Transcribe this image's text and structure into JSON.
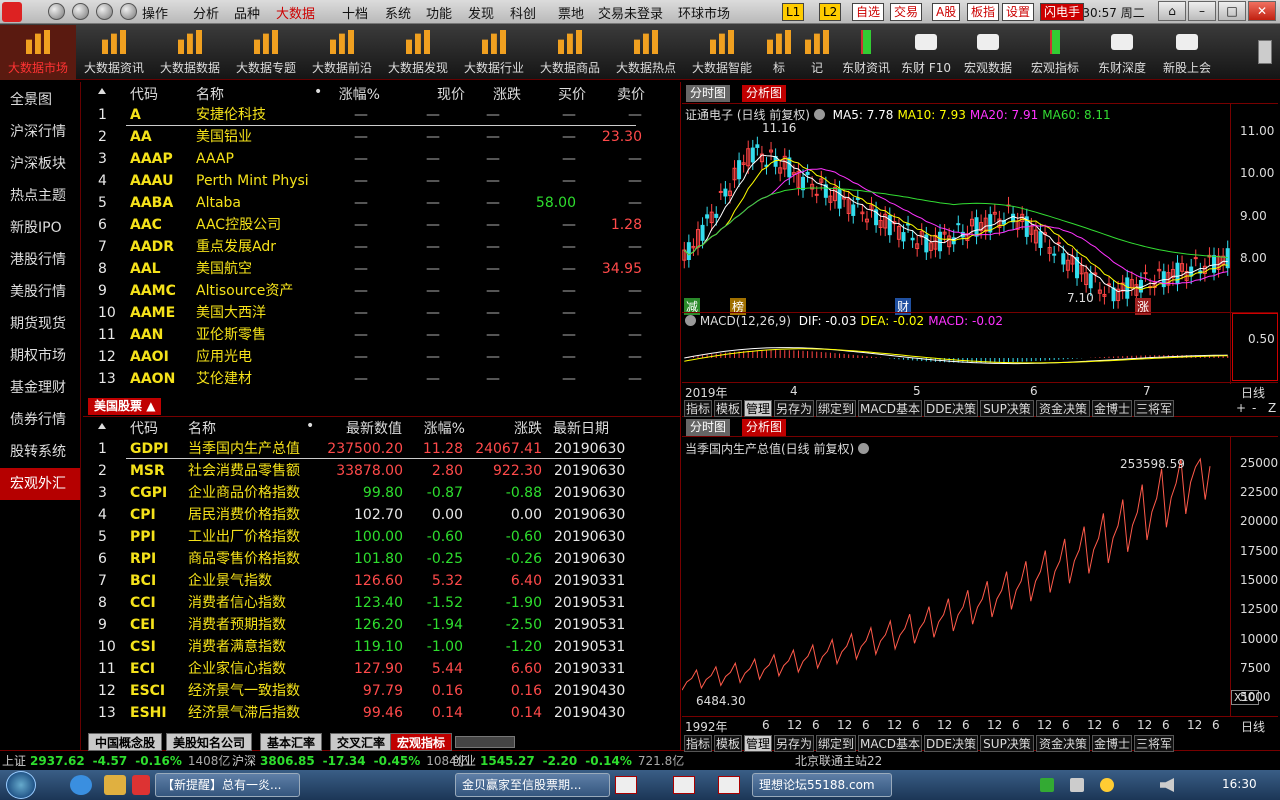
{
  "menubar": {
    "items": [
      "操作",
      "分析",
      "品种",
      "大数据",
      "十档",
      "系统",
      "功能",
      "发现",
      "科创",
      "票地",
      "交易未登录",
      "环球市场"
    ],
    "active_index": 3,
    "toggles": [
      "L1",
      "L2",
      "自选",
      "交易",
      "A股",
      "板指",
      "设置",
      "闪电手"
    ],
    "clock": "16:30:57",
    "weekday": "周二"
  },
  "toolbar": {
    "items": [
      "大数据市场",
      "大数据资讯",
      "大数据数据",
      "大数据专题",
      "大数据前沿",
      "大数据发现",
      "大数据行业",
      "大数据商品",
      "大数据热点",
      "大数据智能",
      "标",
      "记",
      "东财资讯",
      "东财 F10",
      "宏观数据",
      "宏观指标",
      "东财深度",
      "新股上会"
    ],
    "active_index": 0
  },
  "sidebar": {
    "items": [
      "全景图",
      "沪深行情",
      "沪深板块",
      "热点主题",
      "新股IPO",
      "港股行情",
      "美股行情",
      "期货现货",
      "期权市场",
      "基金理财",
      "债券行情",
      "股转系统",
      "宏观外汇"
    ],
    "active_index": 12
  },
  "us_table": {
    "headers": [
      "代码",
      "名称",
      "•",
      "涨幅%",
      "现价",
      "涨跌",
      "买价",
      "卖价"
    ],
    "rows": [
      {
        "n": "1",
        "code": "A",
        "name": "安捷伦科技",
        "chg": "—",
        "price": "—",
        "diff": "—",
        "bid": "—",
        "ask": "—"
      },
      {
        "n": "2",
        "code": "AA",
        "name": "美国铝业",
        "chg": "—",
        "price": "—",
        "diff": "—",
        "bid": "—",
        "ask": "23.30"
      },
      {
        "n": "3",
        "code": "AAAP",
        "name": "AAAP",
        "chg": "—",
        "price": "—",
        "diff": "—",
        "bid": "—",
        "ask": "—"
      },
      {
        "n": "4",
        "code": "AAAU",
        "name": "Perth Mint Physi",
        "chg": "—",
        "price": "—",
        "diff": "—",
        "bid": "—",
        "ask": "—"
      },
      {
        "n": "5",
        "code": "AABA",
        "name": "Altaba",
        "chg": "—",
        "price": "—",
        "diff": "—",
        "bid": "58.00",
        "ask": "—"
      },
      {
        "n": "6",
        "code": "AAC",
        "name": "AAC控股公司",
        "chg": "—",
        "price": "—",
        "diff": "—",
        "bid": "—",
        "ask": "1.28"
      },
      {
        "n": "7",
        "code": "AADR",
        "name": "重点发展Adr",
        "chg": "—",
        "price": "—",
        "diff": "—",
        "bid": "—",
        "ask": "—"
      },
      {
        "n": "8",
        "code": "AAL",
        "name": "美国航空",
        "chg": "—",
        "price": "—",
        "diff": "—",
        "bid": "—",
        "ask": "34.95"
      },
      {
        "n": "9",
        "code": "AAMC",
        "name": "Altisource资产",
        "chg": "—",
        "price": "—",
        "diff": "—",
        "bid": "—",
        "ask": "—"
      },
      {
        "n": "10",
        "code": "AAME",
        "name": "美国大西洋",
        "chg": "—",
        "price": "—",
        "diff": "—",
        "bid": "—",
        "ask": "—"
      },
      {
        "n": "11",
        "code": "AAN",
        "name": "亚伦斯零售",
        "chg": "—",
        "price": "—",
        "diff": "—",
        "bid": "—",
        "ask": "—"
      },
      {
        "n": "12",
        "code": "AAOI",
        "name": "应用光电",
        "chg": "—",
        "price": "—",
        "diff": "—",
        "bid": "—",
        "ask": "—"
      },
      {
        "n": "13",
        "code": "AAON",
        "name": "艾伦建材",
        "chg": "—",
        "price": "—",
        "diff": "—",
        "bid": "—",
        "ask": "—"
      }
    ],
    "tab_label": "美国股票"
  },
  "macro_table": {
    "headers": [
      "代码",
      "名称",
      "•",
      "最新数值",
      "涨幅%",
      "涨跌",
      "最新日期"
    ],
    "rows": [
      {
        "n": "1",
        "code": "GDPI",
        "name": "当季国内生产总值",
        "val": "237500.20",
        "chg": "11.28",
        "diff": "24067.41",
        "date": "20190630",
        "dir": "up"
      },
      {
        "n": "2",
        "code": "MSR",
        "name": "社会消费品零售额",
        "val": "33878.00",
        "chg": "2.80",
        "diff": "922.30",
        "date": "20190630",
        "dir": "up"
      },
      {
        "n": "3",
        "code": "CGPI",
        "name": "企业商品价格指数",
        "val": "99.80",
        "chg": "-0.87",
        "diff": "-0.88",
        "date": "20190630",
        "dir": "down"
      },
      {
        "n": "4",
        "code": "CPI",
        "name": "居民消费价格指数",
        "val": "102.70",
        "chg": "0.00",
        "diff": "0.00",
        "date": "20190630",
        "dir": "flat"
      },
      {
        "n": "5",
        "code": "PPI",
        "name": "工业出厂价格指数",
        "val": "100.00",
        "chg": "-0.60",
        "diff": "-0.60",
        "date": "20190630",
        "dir": "down"
      },
      {
        "n": "6",
        "code": "RPI",
        "name": "商品零售价格指数",
        "val": "101.80",
        "chg": "-0.25",
        "diff": "-0.26",
        "date": "20190630",
        "dir": "down"
      },
      {
        "n": "7",
        "code": "BCI",
        "name": "企业景气指数",
        "val": "126.60",
        "chg": "5.32",
        "diff": "6.40",
        "date": "20190331",
        "dir": "up"
      },
      {
        "n": "8",
        "code": "CCI",
        "name": "消费者信心指数",
        "val": "123.40",
        "chg": "-1.52",
        "diff": "-1.90",
        "date": "20190531",
        "dir": "down"
      },
      {
        "n": "9",
        "code": "CEI",
        "name": "消费者预期指数",
        "val": "126.20",
        "chg": "-1.94",
        "diff": "-2.50",
        "date": "20190531",
        "dir": "down"
      },
      {
        "n": "10",
        "code": "CSI",
        "name": "消费者满意指数",
        "val": "119.10",
        "chg": "-1.00",
        "diff": "-1.20",
        "date": "20190531",
        "dir": "down"
      },
      {
        "n": "11",
        "code": "ECI",
        "name": "企业家信心指数",
        "val": "127.90",
        "chg": "5.44",
        "diff": "6.60",
        "date": "20190331",
        "dir": "up"
      },
      {
        "n": "12",
        "code": "ESCI",
        "name": "经济景气一致指数",
        "val": "97.79",
        "chg": "0.16",
        "diff": "0.16",
        "date": "20190430",
        "dir": "up"
      },
      {
        "n": "13",
        "code": "ESHI",
        "name": "经济景气滞后指数",
        "val": "99.46",
        "chg": "0.14",
        "diff": "0.14",
        "date": "20190430",
        "dir": "up"
      }
    ]
  },
  "bottom_tabs": [
    "中国概念股",
    "美股知名公司",
    "基本汇率",
    "交叉汇率",
    "宏观指标"
  ],
  "bottom_tabs_active": 4,
  "chart_top": {
    "tabs": [
      "分时图",
      "分析图"
    ],
    "title": "证通电子 (日线 前复权)",
    "ma": [
      {
        "label": "MA5: 7.78",
        "color": "#ffffff"
      },
      {
        "label": "MA10: 7.93",
        "color": "#ffff00"
      },
      {
        "label": "MA20: 7.91",
        "color": "#ff33ff"
      },
      {
        "label": "MA60: 8.11",
        "color": "#33dd33"
      }
    ],
    "high_label": "11.16",
    "low_label": "7.10",
    "markers": [
      "减",
      "榜",
      "财",
      "涨"
    ],
    "yticks": [
      "11.00",
      "10.00",
      "9.00",
      "8.00"
    ],
    "macd_title": "MACD(12,26,9)",
    "macd_vals": [
      {
        "label": "DIF: -0.03",
        "color": "#ffffff"
      },
      {
        "label": "DEA: -0.02",
        "color": "#ffff00"
      },
      {
        "label": "MACD: -0.02",
        "color": "#ff33ff"
      }
    ],
    "macd_ytick": "0.50",
    "xlabels": [
      "2019年",
      "4",
      "5",
      "6",
      "7"
    ],
    "period": "日线",
    "tool_tabs": [
      "指标",
      "模板",
      "管理",
      "另存为",
      "绑定到",
      "MACD基本",
      "DDE决策",
      "SUP决策",
      "资金决策",
      "金博士",
      "三将军"
    ],
    "tool_controls": [
      "+",
      "-",
      "Z"
    ]
  },
  "chart_data": {
    "type": "line",
    "title": "当季国内生产总值(日线 前复权)",
    "xlabels": [
      "1992年",
      "6",
      "12",
      "6",
      "12",
      "6",
      "12",
      "6",
      "12",
      "6",
      "12",
      "6",
      "12",
      "6",
      "12",
      "6",
      "12",
      "6",
      "12",
      "6",
      "12",
      "6",
      "12",
      "6",
      "12",
      "6",
      "12",
      "6",
      "12",
      "6",
      "12",
      "6",
      "12",
      "6",
      "12",
      "6",
      "12",
      "6",
      "12",
      "6",
      "12",
      "6",
      "12",
      "6",
      "12",
      "6",
      "12",
      "6",
      "12",
      "6",
      "12",
      "6",
      "12",
      "6",
      "12",
      "6",
      "12",
      "6"
    ],
    "yticks": [
      "25000",
      "22500",
      "20000",
      "17500",
      "15000",
      "12500",
      "10000",
      "7500",
      "5000"
    ],
    "ylim": [
      3500,
      26000
    ],
    "start_value": 6484.3,
    "max_value": 253598.59,
    "start_label": "6484.30",
    "max_label": "253598.59",
    "scale_badge": "X10",
    "period": "日线"
  },
  "chart_bottom": {
    "tabs": [
      "分时图",
      "分析图"
    ],
    "tool_tabs": [
      "指标",
      "模板",
      "管理",
      "另存为",
      "绑定到",
      "MACD基本",
      "DDE决策",
      "SUP决策",
      "资金决策",
      "金博士",
      "三将军"
    ]
  },
  "statusbar": [
    {
      "name": "上证",
      "val": "2937.62",
      "diff": "-4.57",
      "pct": "-0.16%",
      "amt": "1408亿"
    },
    {
      "name": "沪深",
      "val": "3806.85",
      "diff": "-17.34",
      "pct": "-0.45%",
      "amt": "1084亿"
    },
    {
      "name": "创业",
      "val": "1545.27",
      "diff": "-2.20",
      "pct": "-0.14%",
      "amt": "721.8亿"
    }
  ],
  "status_right": "北京联通主站22",
  "taskbar": {
    "tasks": [
      "【新提醒】总有一炎...",
      "金贝赢家至信股票期...",
      "理想论坛55188.com"
    ],
    "time": "16:30"
  }
}
